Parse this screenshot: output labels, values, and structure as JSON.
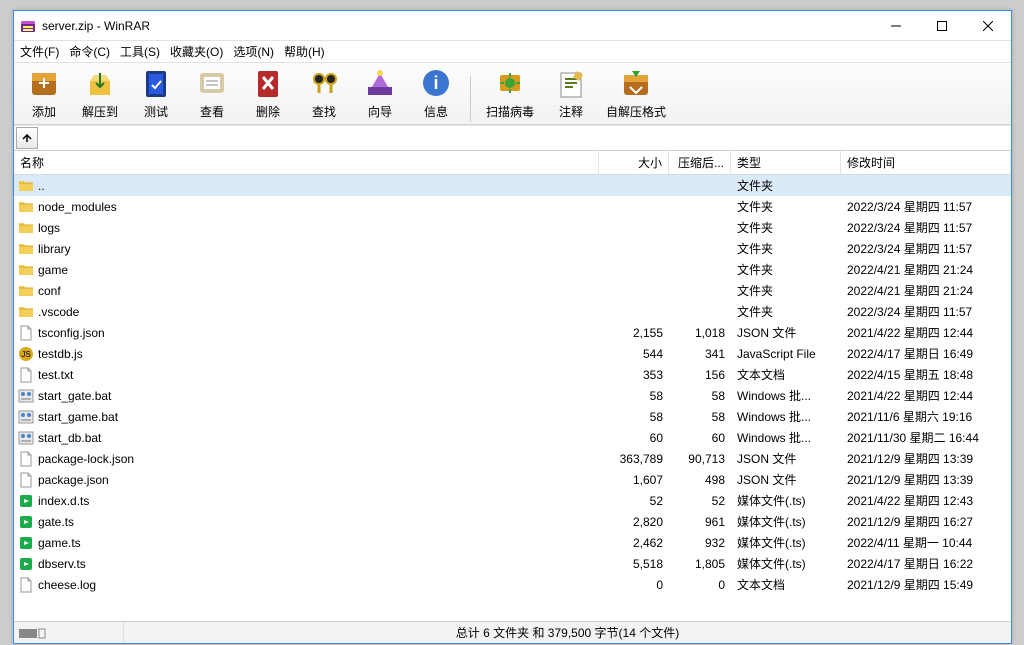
{
  "window": {
    "title": "server.zip - WinRAR"
  },
  "menu": {
    "file": "文件(F)",
    "command": "命令(C)",
    "tools": "工具(S)",
    "favorites": "收藏夹(O)",
    "options": "选项(N)",
    "help": "帮助(H)"
  },
  "toolbar": {
    "add": "添加",
    "extract": "解压到",
    "test": "测试",
    "view": "查看",
    "delete": "删除",
    "find": "查找",
    "wizard": "向导",
    "info": "信息",
    "virusscan": "扫描病毒",
    "comment": "注释",
    "sfx": "自解压格式"
  },
  "columns": {
    "name": "名称",
    "size": "大小",
    "packed": "压缩后...",
    "type": "类型",
    "mtime": "修改时间"
  },
  "status": {
    "summary": "总计 6 文件夹 和 379,500 字节(14 个文件)"
  },
  "types": {
    "folder": "文件夹",
    "json": "JSON 文件",
    "js": "JavaScript File",
    "txt": "文本文档",
    "bat": "Windows 批...",
    "ts": "媒体文件(.ts)"
  },
  "rows": [
    {
      "icon": "folder",
      "name": "..",
      "size": "",
      "packed": "",
      "typeKey": "folder",
      "mtime": "",
      "sel": true
    },
    {
      "icon": "folder",
      "name": "node_modules",
      "size": "",
      "packed": "",
      "typeKey": "folder",
      "mtime": "2022/3/24 星期四 11:57"
    },
    {
      "icon": "folder",
      "name": "logs",
      "size": "",
      "packed": "",
      "typeKey": "folder",
      "mtime": "2022/3/24 星期四 11:57"
    },
    {
      "icon": "folder",
      "name": "library",
      "size": "",
      "packed": "",
      "typeKey": "folder",
      "mtime": "2022/3/24 星期四 11:57"
    },
    {
      "icon": "folder",
      "name": "game",
      "size": "",
      "packed": "",
      "typeKey": "folder",
      "mtime": "2022/4/21 星期四 21:24"
    },
    {
      "icon": "folder",
      "name": "conf",
      "size": "",
      "packed": "",
      "typeKey": "folder",
      "mtime": "2022/4/21 星期四 21:24"
    },
    {
      "icon": "folder",
      "name": ".vscode",
      "size": "",
      "packed": "",
      "typeKey": "folder",
      "mtime": "2022/3/24 星期四 11:57"
    },
    {
      "icon": "file",
      "name": "tsconfig.json",
      "size": "2,155",
      "packed": "1,018",
      "typeKey": "json",
      "mtime": "2021/4/22 星期四 12:44"
    },
    {
      "icon": "js",
      "name": "testdb.js",
      "size": "544",
      "packed": "341",
      "typeKey": "js",
      "mtime": "2022/4/17 星期日 16:49"
    },
    {
      "icon": "file",
      "name": "test.txt",
      "size": "353",
      "packed": "156",
      "typeKey": "txt",
      "mtime": "2022/4/15 星期五 18:48"
    },
    {
      "icon": "bat",
      "name": "start_gate.bat",
      "size": "58",
      "packed": "58",
      "typeKey": "bat",
      "mtime": "2021/4/22 星期四 12:44"
    },
    {
      "icon": "bat",
      "name": "start_game.bat",
      "size": "58",
      "packed": "58",
      "typeKey": "bat",
      "mtime": "2021/11/6 星期六 19:16"
    },
    {
      "icon": "bat",
      "name": "start_db.bat",
      "size": "60",
      "packed": "60",
      "typeKey": "bat",
      "mtime": "2021/11/30 星期二 16:44"
    },
    {
      "icon": "file",
      "name": "package-lock.json",
      "size": "363,789",
      "packed": "90,713",
      "typeKey": "json",
      "mtime": "2021/12/9 星期四 13:39"
    },
    {
      "icon": "file",
      "name": "package.json",
      "size": "1,607",
      "packed": "498",
      "typeKey": "json",
      "mtime": "2021/12/9 星期四 13:39"
    },
    {
      "icon": "ts",
      "name": "index.d.ts",
      "size": "52",
      "packed": "52",
      "typeKey": "ts",
      "mtime": "2021/4/22 星期四 12:43"
    },
    {
      "icon": "ts",
      "name": "gate.ts",
      "size": "2,820",
      "packed": "961",
      "typeKey": "ts",
      "mtime": "2021/12/9 星期四 16:27"
    },
    {
      "icon": "ts",
      "name": "game.ts",
      "size": "2,462",
      "packed": "932",
      "typeKey": "ts",
      "mtime": "2022/4/11 星期一 10:44"
    },
    {
      "icon": "ts",
      "name": "dbserv.ts",
      "size": "5,518",
      "packed": "1,805",
      "typeKey": "ts",
      "mtime": "2022/4/17 星期日 16:22"
    },
    {
      "icon": "file",
      "name": "cheese.log",
      "size": "0",
      "packed": "0",
      "typeKey": "txt",
      "mtime": "2021/12/9 星期四 15:49"
    }
  ]
}
